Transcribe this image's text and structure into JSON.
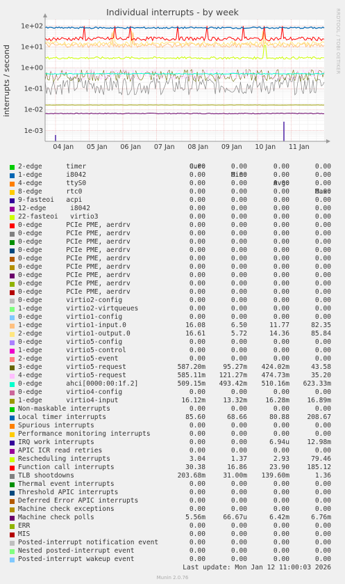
{
  "chart_data": {
    "type": "line",
    "title": "Individual interrupts - by week",
    "ylabel": "interrupts / second",
    "yscale": "log",
    "ylim": [
      0.0003,
      200
    ],
    "y_ticks": [
      "1e-03",
      "1e-02",
      "1e-01",
      "1e+00",
      "1e+01",
      "1e+02"
    ],
    "x_ticks": [
      "04 Jan",
      "05 Jan",
      "06 Jan",
      "07 Jan",
      "08 Jan",
      "09 Jan",
      "10 Jan",
      "11 Jan"
    ],
    "grid": true,
    "legend_columns": [
      "Cur:",
      "Min:",
      "Avg:",
      "Max:"
    ],
    "series": [
      {
        "name": "2-edge      timer",
        "color": "#00cc00",
        "cur": "0.00",
        "min": "0.00",
        "avg": "0.00",
        "max": "0.00"
      },
      {
        "name": "1-edge      i8042",
        "color": "#0066b3",
        "cur": "0.00",
        "min": "0.00",
        "avg": "0.00",
        "max": "0.00"
      },
      {
        "name": "4-edge      ttyS0",
        "color": "#ff8000",
        "cur": "0.00",
        "min": "0.00",
        "avg": "0.00",
        "max": "0.00"
      },
      {
        "name": "8-edge      rtc0",
        "color": "#ffcc00",
        "cur": "0.00",
        "min": "0.00",
        "avg": "0.00",
        "max": "0.00"
      },
      {
        "name": "9-fasteoi   acpi",
        "color": "#330099",
        "cur": "0.00",
        "min": "0.00",
        "avg": "0.00",
        "max": "0.00"
      },
      {
        "name": "12-edge      i8042",
        "color": "#990099",
        "cur": "0.00",
        "min": "0.00",
        "avg": "0.00",
        "max": "0.00"
      },
      {
        "name": "22-fasteoi   virtio3",
        "color": "#ccff00",
        "cur": "0.00",
        "min": "0.00",
        "avg": "0.00",
        "max": "0.00"
      },
      {
        "name": "0-edge      PCIe PME, aerdrv",
        "color": "#ff0000",
        "cur": "0.00",
        "min": "0.00",
        "avg": "0.00",
        "max": "0.00"
      },
      {
        "name": "0-edge      PCIe PME, aerdrv",
        "color": "#808080",
        "cur": "0.00",
        "min": "0.00",
        "avg": "0.00",
        "max": "0.00"
      },
      {
        "name": "0-edge      PCIe PME, aerdrv",
        "color": "#008f00",
        "cur": "0.00",
        "min": "0.00",
        "avg": "0.00",
        "max": "0.00"
      },
      {
        "name": "0-edge      PCIe PME, aerdrv",
        "color": "#00487d",
        "cur": "0.00",
        "min": "0.00",
        "avg": "0.00",
        "max": "0.00"
      },
      {
        "name": "0-edge      PCIe PME, aerdrv",
        "color": "#b35a00",
        "cur": "0.00",
        "min": "0.00",
        "avg": "0.00",
        "max": "0.00"
      },
      {
        "name": "0-edge      PCIe PME, aerdrv",
        "color": "#b38f00",
        "cur": "0.00",
        "min": "0.00",
        "avg": "0.00",
        "max": "0.00"
      },
      {
        "name": "0-edge      PCIe PME, aerdrv",
        "color": "#6b006b",
        "cur": "0.00",
        "min": "0.00",
        "avg": "0.00",
        "max": "0.00"
      },
      {
        "name": "0-edge      PCIe PME, aerdrv",
        "color": "#8fb300",
        "cur": "0.00",
        "min": "0.00",
        "avg": "0.00",
        "max": "0.00"
      },
      {
        "name": "0-edge      PCIe PME, aerdrv",
        "color": "#b30000",
        "cur": "0.00",
        "min": "0.00",
        "avg": "0.00",
        "max": "0.00"
      },
      {
        "name": "0-edge      virtio2-config",
        "color": "#bebebe",
        "cur": "0.00",
        "min": "0.00",
        "avg": "0.00",
        "max": "0.00"
      },
      {
        "name": "1-edge      virtio2-virtqueues",
        "color": "#80ff80",
        "cur": "0.00",
        "min": "0.00",
        "avg": "0.00",
        "max": "0.00"
      },
      {
        "name": "0-edge      virtio1-config",
        "color": "#80c9ff",
        "cur": "0.00",
        "min": "0.00",
        "avg": "0.00",
        "max": "0.00"
      },
      {
        "name": "1-edge      virtio1-input.0",
        "color": "#ffc080",
        "cur": "16.08",
        "min": "6.50",
        "avg": "11.77",
        "max": "82.35"
      },
      {
        "name": "2-edge      virtio1-output.0",
        "color": "#ffe680",
        "cur": "16.61",
        "min": "5.72",
        "avg": "14.36",
        "max": "85.84"
      },
      {
        "name": "0-edge      virtio5-config",
        "color": "#aa80ff",
        "cur": "0.00",
        "min": "0.00",
        "avg": "0.00",
        "max": "0.00"
      },
      {
        "name": "1-edge      virtio5-control",
        "color": "#ee00cc",
        "cur": "0.00",
        "min": "0.00",
        "avg": "0.00",
        "max": "0.00"
      },
      {
        "name": "2-edge      virtio5-event",
        "color": "#ff8080",
        "cur": "0.00",
        "min": "0.00",
        "avg": "0.00",
        "max": "0.00"
      },
      {
        "name": "3-edge      virtio5-request",
        "color": "#666600",
        "cur": "587.20m",
        "min": "95.27m",
        "avg": "424.02m",
        "max": "43.58"
      },
      {
        "name": "4-edge      virtio5-request",
        "color": "#ffbfff",
        "cur": "585.11m",
        "min": "121.27m",
        "avg": "474.73m",
        "max": "35.20"
      },
      {
        "name": "0-edge      ahci[0000:00:1f.2]",
        "color": "#00ffcc",
        "cur": "509.15m",
        "min": "493.42m",
        "avg": "510.16m",
        "max": "623.33m"
      },
      {
        "name": "0-edge      virtio4-config",
        "color": "#cc6699",
        "cur": "0.00",
        "min": "0.00",
        "avg": "0.00",
        "max": "0.00"
      },
      {
        "name": "1-edge      virtio4-input",
        "color": "#999900",
        "cur": "16.12m",
        "min": "13.32m",
        "avg": "16.28m",
        "max": "16.89m"
      },
      {
        "name": "Non-maskable interrupts",
        "color": "#00cc00",
        "cur": "0.00",
        "min": "0.00",
        "avg": "0.00",
        "max": "0.00"
      },
      {
        "name": "Local timer interrupts",
        "color": "#0066b3",
        "cur": "85.60",
        "min": "68.66",
        "avg": "80.88",
        "max": "208.67"
      },
      {
        "name": "Spurious interrupts",
        "color": "#ff8000",
        "cur": "0.00",
        "min": "0.00",
        "avg": "0.00",
        "max": "0.00"
      },
      {
        "name": "Performance monitoring interrupts",
        "color": "#ffcc00",
        "cur": "0.00",
        "min": "0.00",
        "avg": "0.00",
        "max": "0.00"
      },
      {
        "name": "IRQ work interrupts",
        "color": "#330099",
        "cur": "0.00",
        "min": "0.00",
        "avg": "6.94u",
        "max": "12.98m"
      },
      {
        "name": "APIC ICR read retries",
        "color": "#990099",
        "cur": "0.00",
        "min": "0.00",
        "avg": "0.00",
        "max": "0.00"
      },
      {
        "name": "Rescheduling interrupts",
        "color": "#ccff00",
        "cur": "3.04",
        "min": "1.37",
        "avg": "2.93",
        "max": "79.46"
      },
      {
        "name": "Function call interrupts",
        "color": "#ff0000",
        "cur": "30.38",
        "min": "16.86",
        "avg": "23.90",
        "max": "185.12"
      },
      {
        "name": "TLB shootdowns",
        "color": "#808080",
        "cur": "203.68m",
        "min": "31.00m",
        "avg": "139.60m",
        "max": "1.36"
      },
      {
        "name": "Thermal event interrupts",
        "color": "#008f00",
        "cur": "0.00",
        "min": "0.00",
        "avg": "0.00",
        "max": "0.00"
      },
      {
        "name": "Threshold APIC interrupts",
        "color": "#00487d",
        "cur": "0.00",
        "min": "0.00",
        "avg": "0.00",
        "max": "0.00"
      },
      {
        "name": "Deferred Error APIC interrupts",
        "color": "#b35a00",
        "cur": "0.00",
        "min": "0.00",
        "avg": "0.00",
        "max": "0.00"
      },
      {
        "name": "Machine check exceptions",
        "color": "#b38f00",
        "cur": "0.00",
        "min": "0.00",
        "avg": "0.00",
        "max": "0.00"
      },
      {
        "name": "Machine check polls",
        "color": "#6b006b",
        "cur": "5.56m",
        "min": "66.67u",
        "avg": "6.42m",
        "max": "6.76m"
      },
      {
        "name": "ERR",
        "color": "#8fb300",
        "cur": "0.00",
        "min": "0.00",
        "avg": "0.00",
        "max": "0.00"
      },
      {
        "name": "MIS",
        "color": "#b30000",
        "cur": "0.00",
        "min": "0.00",
        "avg": "0.00",
        "max": "0.00"
      },
      {
        "name": "Posted-interrupt notification event",
        "color": "#bebebe",
        "cur": "0.00",
        "min": "0.00",
        "avg": "0.00",
        "max": "0.00"
      },
      {
        "name": "Nested posted-interrupt event",
        "color": "#80ff80",
        "cur": "0.00",
        "min": "0.00",
        "avg": "0.00",
        "max": "0.00"
      },
      {
        "name": "Posted-interrupt wakeup event",
        "color": "#80c9ff",
        "cur": "0.00",
        "min": "0.00",
        "avg": "0.00",
        "max": "0.00"
      }
    ]
  },
  "header": {
    "credit": "RRDTOOL / TOBI OETIKER"
  },
  "footer": {
    "last_update": "Last update: Mon Jan 12 11:00:03 2026",
    "version": "Munin 2.0.76"
  }
}
